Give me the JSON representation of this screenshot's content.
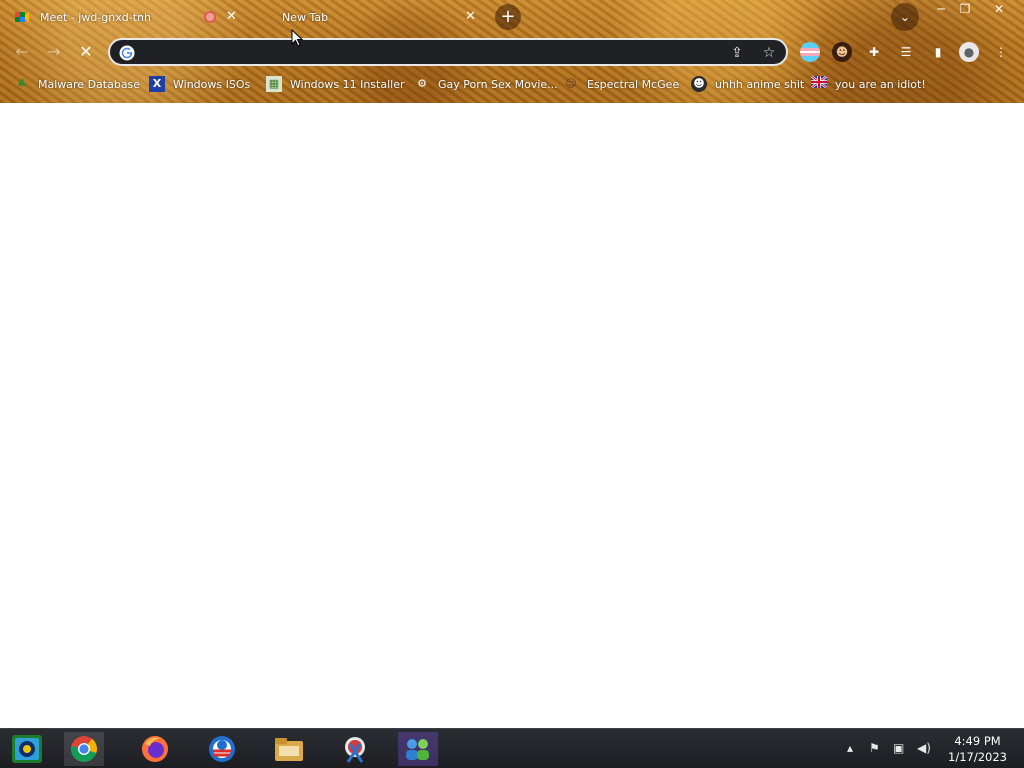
{
  "browser": {
    "tabs": [
      {
        "title": "Meet - jwd-gnxd-tnh",
        "recording": true
      },
      {
        "title": "New Tab"
      }
    ],
    "new_tab_label": "+",
    "omnibox": {
      "value": "",
      "placeholder": ""
    },
    "window_controls": {
      "minimize": "─",
      "restore": "❐",
      "close": "✕"
    }
  },
  "bookmarks": [
    {
      "label": "Malware Database",
      "icon": "leaf-icon"
    },
    {
      "label": "Windows ISOs",
      "icon": "x-logo-icon"
    },
    {
      "label": "Windows 11 Installer",
      "icon": "image-icon"
    },
    {
      "label": "Gay Porn Sex Movie...",
      "icon": "robot-icon"
    },
    {
      "label": "Espectral McGee",
      "icon": "face-icon"
    },
    {
      "label": "uhhh anime shit",
      "icon": "anime-face-icon"
    },
    {
      "label": "you are an idiot!",
      "icon": "flag-icon"
    }
  ],
  "taskbar": {
    "time": "4:49 PM",
    "date": "1/17/2023"
  }
}
